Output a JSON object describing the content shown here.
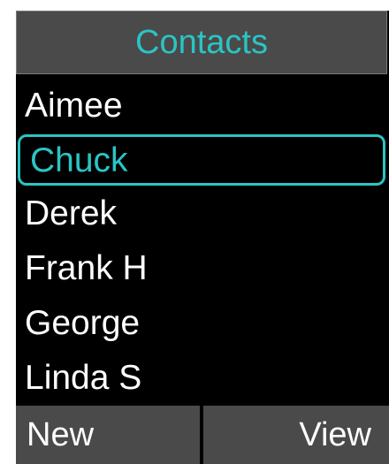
{
  "header": {
    "title": "Contacts"
  },
  "contacts": {
    "items": [
      {
        "label": "Aimee"
      },
      {
        "label": "Chuck",
        "selected": true
      },
      {
        "label": "Derek"
      },
      {
        "label": "Frank H"
      },
      {
        "label": "George"
      },
      {
        "label": "Linda S"
      }
    ]
  },
  "softkeys": {
    "left_label": "New",
    "right_label": "View"
  },
  "colors": {
    "accent": "#2bc4c4",
    "bar_bg": "#4a4a4a",
    "screen_bg": "#000000",
    "text": "#ffffff"
  }
}
